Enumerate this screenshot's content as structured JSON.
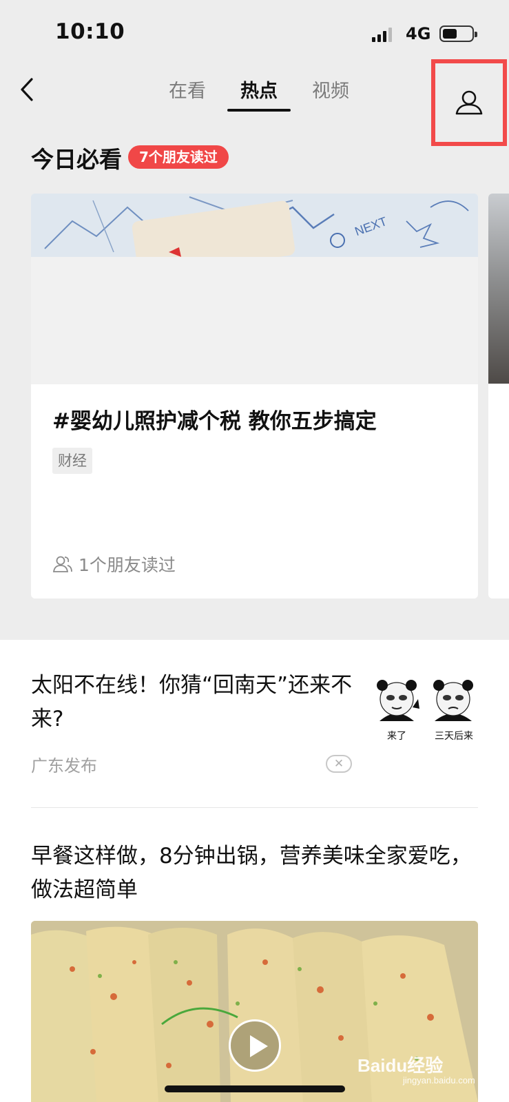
{
  "status_bar": {
    "time": "10:10",
    "network": "4G"
  },
  "nav": {
    "tabs": [
      {
        "label": "在看"
      },
      {
        "label": "热点"
      },
      {
        "label": "视频"
      }
    ],
    "active_tab": "热点"
  },
  "must_read": {
    "title": "今日必看",
    "badge": "7个朋友读过",
    "card": {
      "title": "#婴幼儿照护减个税 教你五步搞定",
      "tag": "财经",
      "friends_read": "1个朋友读过"
    }
  },
  "feed": {
    "article1": {
      "title": "太阳不在线！你猜“回南天”还来不来?",
      "source": "广东发布",
      "sticker_captions": [
        "来了",
        "三天后来"
      ]
    },
    "article2": {
      "title": "早餐这样做，8分钟出锅，营养美味全家爱吃，做法超简单"
    }
  },
  "watermark": {
    "brand": "Baidu经验",
    "url": "jingyan.baidu.com"
  },
  "colors": {
    "accent_red": "#f04747",
    "highlight_box": "#f24a4a",
    "background": "#ededed"
  }
}
